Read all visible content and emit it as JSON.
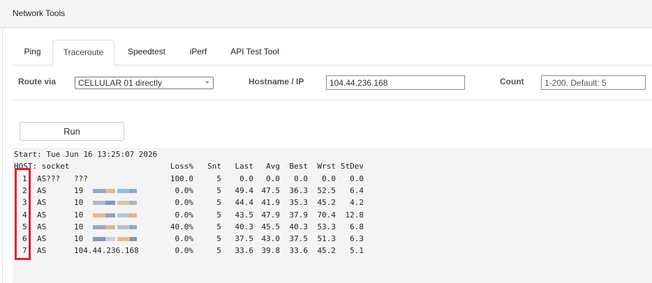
{
  "header": {
    "title": "Network Tools"
  },
  "tabs": [
    {
      "label": "Ping",
      "active": false
    },
    {
      "label": "Traceroute",
      "active": true
    },
    {
      "label": "Speedtest",
      "active": false
    },
    {
      "label": "iPerf",
      "active": false
    },
    {
      "label": "API Test Tool",
      "active": false
    }
  ],
  "form": {
    "route_label": "Route via",
    "route_value": "CELLULAR 01 directly",
    "hostname_label": "Hostname / IP",
    "hostname_value": "104.44.236.168",
    "count_label": "Count",
    "count_placeholder": "1-200. Default: 5"
  },
  "run_label": "Run",
  "output": {
    "start_line": "Start: Tue Jun 16 13:25:07 2026",
    "host_label": "HOST: socket",
    "columns": [
      "Loss%",
      "Snt",
      "Last",
      "Avg",
      "Best",
      "Wrst",
      "StDev"
    ],
    "rows": [
      {
        "num": "1.",
        "as": "AS???",
        "host": "???",
        "loss": "100.0",
        "snt": "5",
        "last": "0.0",
        "avg": "0.0",
        "best": "0.0",
        "wrst": "0.0",
        "stdev": "0.0"
      },
      {
        "num": "2.",
        "as": "AS",
        "host": "19",
        "loss": "0.0%",
        "snt": "5",
        "last": "49.4",
        "avg": "47.5",
        "best": "36.3",
        "wrst": "52.5",
        "stdev": "6.4"
      },
      {
        "num": "3.",
        "as": "AS",
        "host": "10",
        "loss": "0.0%",
        "snt": "5",
        "last": "44.4",
        "avg": "41.9",
        "best": "35.3",
        "wrst": "45.2",
        "stdev": "4.2"
      },
      {
        "num": "4.",
        "as": "AS",
        "host": "10",
        "loss": "0.0%",
        "snt": "5",
        "last": "43.5",
        "avg": "47.9",
        "best": "37.9",
        "wrst": "70.4",
        "stdev": "12.8"
      },
      {
        "num": "5.",
        "as": "AS",
        "host": "10",
        "loss": "40.0%",
        "snt": "5",
        "last": "40.3",
        "avg": "45.5",
        "best": "40.3",
        "wrst": "53.3",
        "stdev": "6.8"
      },
      {
        "num": "6.",
        "as": "AS",
        "host": "10",
        "loss": "0.0%",
        "snt": "5",
        "last": "37.5",
        "avg": "43.0",
        "best": "37.5",
        "wrst": "51.3",
        "stdev": "6.3"
      },
      {
        "num": "7.",
        "as": "AS",
        "host": "104.44.236.168",
        "loss": "0.0%",
        "snt": "5",
        "last": "33.6",
        "avg": "39.8",
        "best": "33.6",
        "wrst": "45.2",
        "stdev": "5.1"
      }
    ]
  }
}
